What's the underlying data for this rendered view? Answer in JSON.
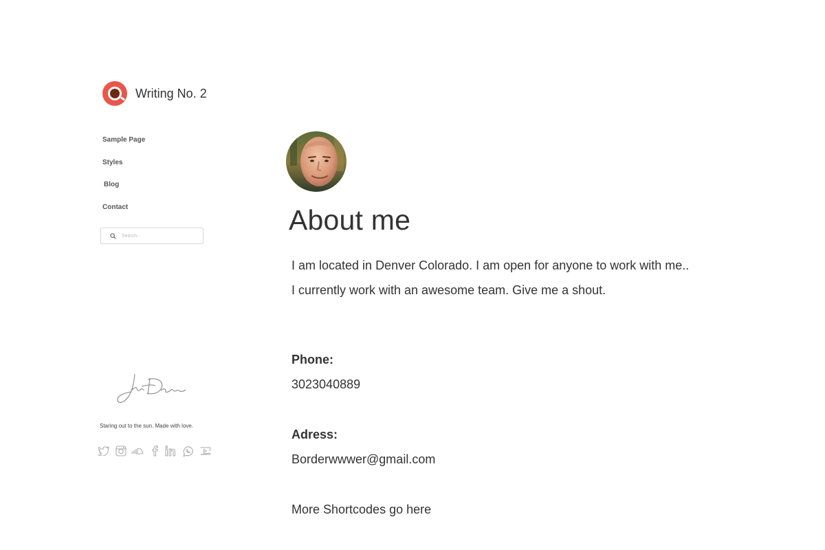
{
  "site": {
    "title": "Writing No. 2",
    "logo_icon": "coffee-cup-icon",
    "accent_color": "#e8574b"
  },
  "nav": {
    "items": [
      {
        "label": "Sample Page"
      },
      {
        "label": "Styles"
      },
      {
        "label": "Blog"
      },
      {
        "label": "Contact"
      }
    ]
  },
  "search": {
    "placeholder": "Search..."
  },
  "footer": {
    "tagline": "Staring out to the sun. Made with love.",
    "social_icons": [
      "twitter-icon",
      "instagram-icon",
      "soundcloud-icon",
      "facebook-icon",
      "linkedin-icon",
      "whatsapp-icon",
      "youtube-icon"
    ]
  },
  "main": {
    "title": "About me",
    "intro": [
      "I am located in Denver Colorado. I am open for anyone to work with me..",
      "I currently work with an awesome team. Give me a shout."
    ],
    "phone_label": "Phone:",
    "phone_value": "3023040889",
    "address_label": "Adress:",
    "address_value": "Borderwwwer@gmail.com",
    "more": "More Shortcodes go here"
  }
}
